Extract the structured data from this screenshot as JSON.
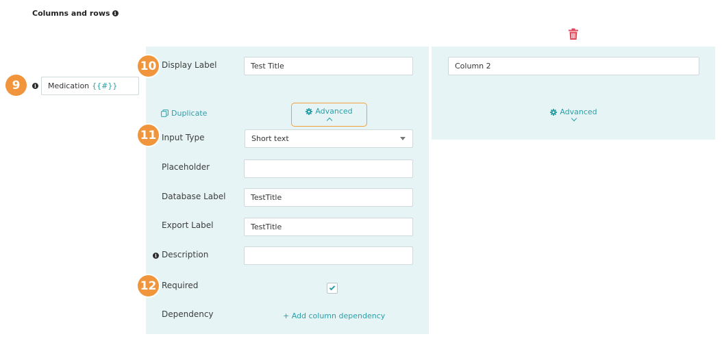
{
  "section": {
    "title": "Columns and rows"
  },
  "badges": {
    "b9": "9",
    "b10": "10",
    "b11": "11",
    "b12": "12"
  },
  "row": {
    "label": "Medication",
    "tag": "{{#}}"
  },
  "column1": {
    "display_label": {
      "label": "Display Label",
      "value": "Test Title"
    },
    "duplicate_label": "Duplicate",
    "advanced_label": "Advanced",
    "input_type": {
      "label": "Input Type",
      "value": "Short text"
    },
    "placeholder": {
      "label": "Placeholder",
      "value": ""
    },
    "database_label": {
      "label": "Database Label",
      "value": "TestTitle"
    },
    "export_label": {
      "label": "Export Label",
      "value": "TestTitle"
    },
    "description": {
      "label": "Description",
      "value": ""
    },
    "required": {
      "label": "Required",
      "checked": true
    },
    "dependency": {
      "label": "Dependency",
      "add_label": "+ Add column dependency"
    }
  },
  "column2": {
    "display_label_value": "Column 2",
    "advanced_label": "Advanced"
  },
  "colors": {
    "accent": "#2a9fa8",
    "badge": "#f0953b",
    "panel": "#e7f4f5",
    "delete": "#e0465a",
    "highlight": "#f0a13a"
  }
}
